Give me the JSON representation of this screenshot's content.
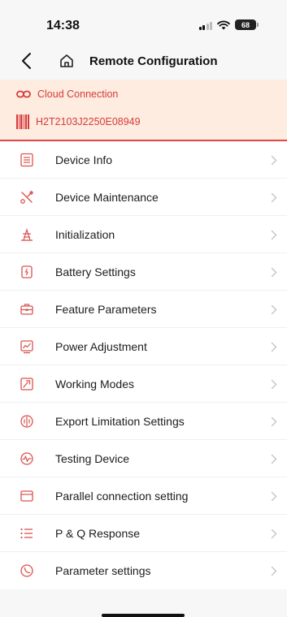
{
  "status_bar": {
    "time": "14:38",
    "battery": "68"
  },
  "nav": {
    "title": "Remote Configuration"
  },
  "banner": {
    "connection_label": "Cloud Connection",
    "serial_number": "H2T2103J2250E08949",
    "accent_color": "#d73a3a"
  },
  "menu": {
    "items": [
      {
        "label": "Device Info",
        "icon": "device-info-icon"
      },
      {
        "label": "Device Maintenance",
        "icon": "device-maintenance-icon"
      },
      {
        "label": "Initialization",
        "icon": "initialization-icon"
      },
      {
        "label": "Battery Settings",
        "icon": "battery-settings-icon"
      },
      {
        "label": "Feature Parameters",
        "icon": "feature-parameters-icon"
      },
      {
        "label": "Power Adjustment",
        "icon": "power-adjustment-icon"
      },
      {
        "label": "Working Modes",
        "icon": "working-modes-icon"
      },
      {
        "label": "Export Limitation Settings",
        "icon": "export-limitation-icon"
      },
      {
        "label": "Testing Device",
        "icon": "testing-device-icon"
      },
      {
        "label": "Parallel connection setting",
        "icon": "parallel-connection-icon"
      },
      {
        "label": "P & Q Response",
        "icon": "pq-response-icon"
      },
      {
        "label": "Parameter settings",
        "icon": "parameter-settings-icon"
      }
    ]
  }
}
